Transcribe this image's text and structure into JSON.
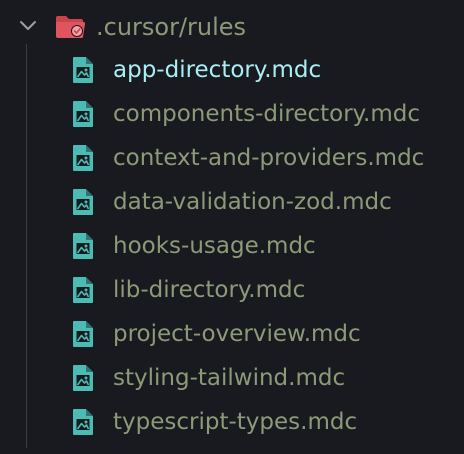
{
  "explorer": {
    "folder": {
      "name": ".cursor/rules",
      "expanded": true,
      "icon": "folder-open-icon",
      "icon_color": "#e0555d",
      "badge_color": "#f3a3a8"
    },
    "files": [
      {
        "name": "app-directory.mdc",
        "active": true
      },
      {
        "name": "components-directory.mdc",
        "active": false
      },
      {
        "name": "context-and-providers.mdc",
        "active": false
      },
      {
        "name": "data-validation-zod.mdc",
        "active": false
      },
      {
        "name": "hooks-usage.mdc",
        "active": false
      },
      {
        "name": "lib-directory.mdc",
        "active": false
      },
      {
        "name": "project-overview.mdc",
        "active": false
      },
      {
        "name": "styling-tailwind.mdc",
        "active": false
      },
      {
        "name": "typescript-types.mdc",
        "active": false
      }
    ],
    "file_icon": "image-file-icon",
    "colors": {
      "background": "#181a1f",
      "file_icon": "#4bbcb3",
      "text": "#8d9a78",
      "active_text": "#a9eef4",
      "guide": "#3a3d44"
    }
  }
}
